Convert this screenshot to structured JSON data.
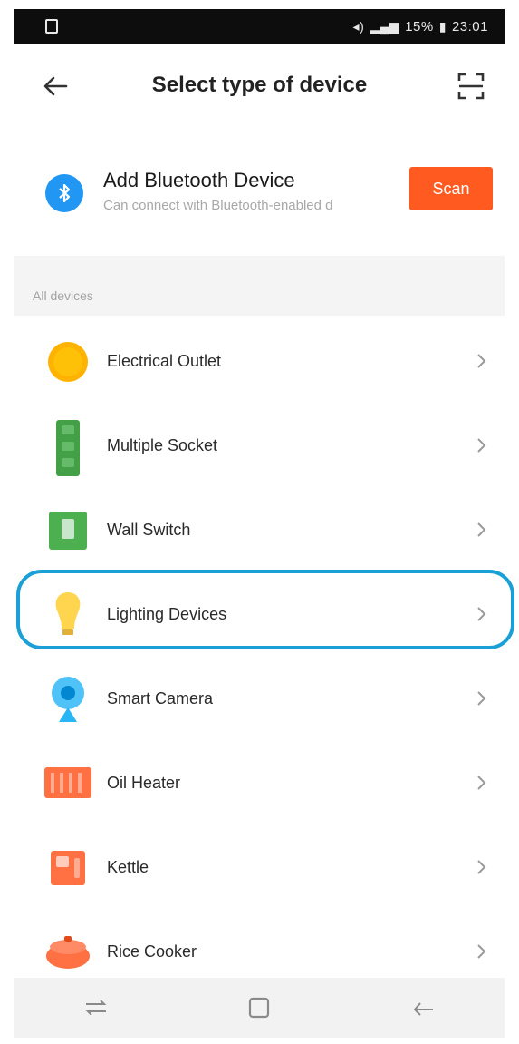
{
  "status_bar": {
    "left_glyphs": "◂)",
    "battery_text": "15%",
    "time": "23:01"
  },
  "header": {
    "title": "Select type of device"
  },
  "bluetooth": {
    "title": "Add Bluetooth Device",
    "subtitle": "Can connect with Bluetooth-enabled d",
    "scan_label": "Scan"
  },
  "section": {
    "label": "All devices"
  },
  "devices": [
    {
      "label": "Electrical Outlet",
      "icon": "outlet-icon"
    },
    {
      "label": "Multiple Socket",
      "icon": "multiple-socket-icon"
    },
    {
      "label": "Wall Switch",
      "icon": "wall-switch-icon"
    },
    {
      "label": "Lighting Devices",
      "icon": "bulb-icon"
    },
    {
      "label": "Smart Camera",
      "icon": "camera-icon"
    },
    {
      "label": "Oil Heater",
      "icon": "heater-icon"
    },
    {
      "label": "Kettle",
      "icon": "kettle-icon"
    },
    {
      "label": "Rice Cooker",
      "icon": "rice-cooker-icon"
    }
  ],
  "colors": {
    "accent": "#ff5a1f",
    "bluetooth": "#2196f3",
    "highlight": "#1aa0d6"
  }
}
